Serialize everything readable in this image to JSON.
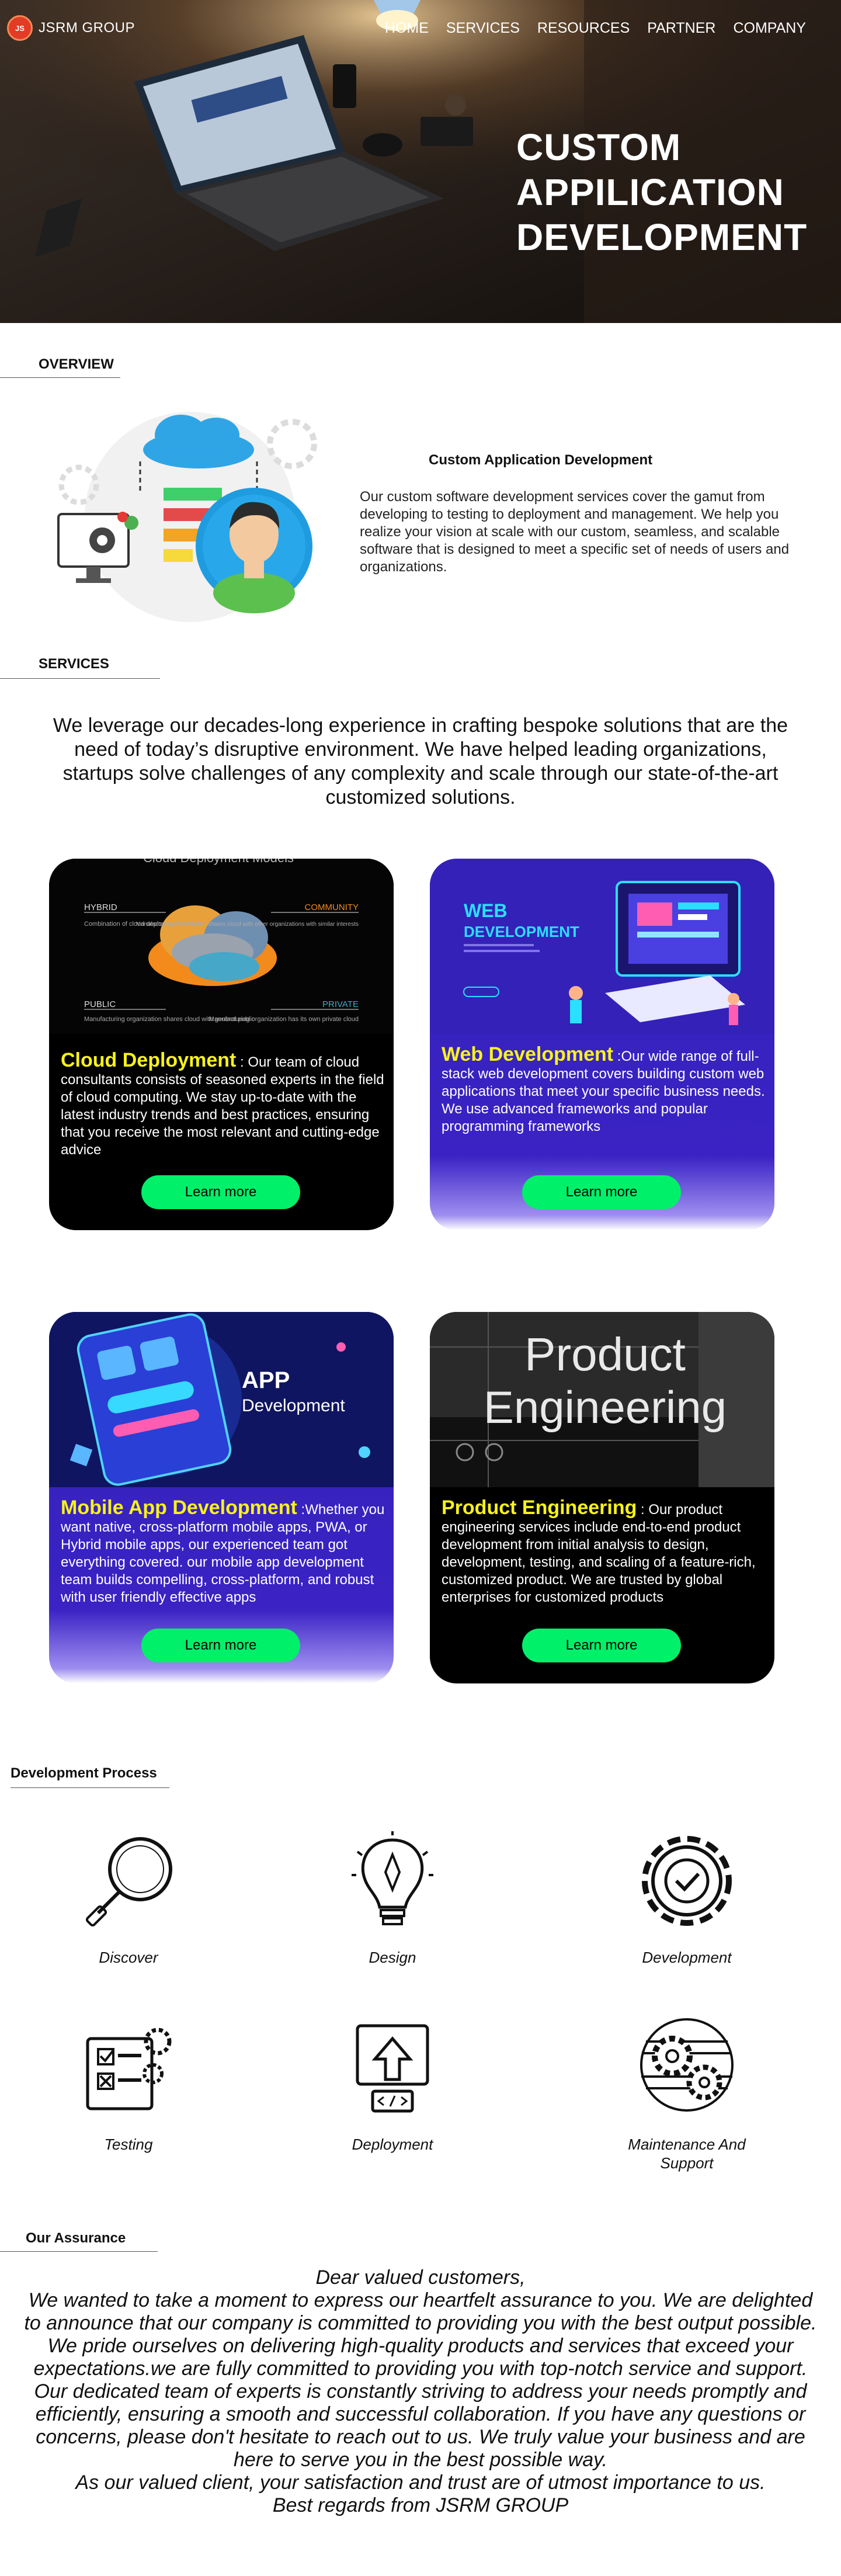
{
  "brand": {
    "name": "JSRM GROUP",
    "badge": "JS"
  },
  "nav": [
    "HOME",
    "SERVICES",
    "RESOURCES",
    "PARTNER",
    "COMPANY"
  ],
  "hero": {
    "title_lines": [
      "CUSTOM",
      "APPILICATION",
      "DEVELOPMENT"
    ]
  },
  "sections": {
    "overview": "OVERVIEW",
    "services": "SERVICES",
    "process": "Development Process",
    "assurance": "Our Assurance"
  },
  "overview": {
    "title": "Custom Application Development",
    "body": "Our custom software development services cover the gamut from developing to testing to deployment and management. We help you realize your vision at scale with our custom, seamless, and scalable software that is designed to meet a specific set of needs of users and organizations."
  },
  "services_intro": "We leverage our decades-long experience in crafting bespoke solutions that are the need of today’s disruptive environment. We have helped leading organizations, startups solve challenges of any complexity and scale through our state-of-the-art customized solutions.",
  "cards": [
    {
      "heading": "Cloud Deployment",
      "body": " : Our team of cloud consultants consists of seasoned experts in the field of cloud computing. We stay up-to-date with the latest industry trends and best practices, ensuring that you receive the most relevant and cutting-edge advice",
      "button": "Learn more",
      "image_text": {
        "title": "Cloud Deployment Models",
        "hybrid": "HYBRID",
        "hybrid_desc": "Combination of cloud deployment models",
        "community": "COMMUNITY",
        "community_desc": "Manufacturing organization shares cloud with other organizations with similar interests",
        "public": "PUBLIC",
        "public_desc": "Manufacturing organization shares cloud with general public",
        "private": "PRIVATE",
        "private_desc": "Manufacturing organization has its own private cloud"
      }
    },
    {
      "heading": "Web Development",
      "body": " :Our wide range of full-stack web development covers building custom web applications that meet your specific business needs. We use advanced frameworks and popular programming frameworks",
      "button": "Learn more",
      "image_text": {
        "line1": "WEB",
        "line2": "DEVELOPMENT"
      }
    },
    {
      "heading": "Mobile App Development",
      "body": "  :Whether you want native, cross-platform mobile apps, PWA, or Hybrid mobile apps, our experienced team got everything covered. our mobile app development team builds compelling, cross-platform, and robust with user friendly effective apps",
      "button": "Learn more",
      "image_text": {
        "line1": "APP",
        "line2": "Development"
      }
    },
    {
      "heading": "Product Engineering",
      "body": " : Our product engineering services include end-to-end product development from initial analysis to design, development, testing, and scaling of a feature-rich, customized product. We are trusted by global enterprises for customized products",
      "button": "Learn more",
      "image_text": {
        "line1": "Product",
        "line2": "Engineering"
      }
    }
  ],
  "process": [
    {
      "label": "Discover",
      "icon": "magnifier-icon"
    },
    {
      "label": "Design",
      "icon": "lightbulb-pen-icon"
    },
    {
      "label": "Development",
      "icon": "gear-check-icon"
    },
    {
      "label": "Testing",
      "icon": "checklist-gears-icon"
    },
    {
      "label": "Deployment",
      "icon": "upload-monitor-icon"
    },
    {
      "label": "Maintenance And Support",
      "icon": "gears-circle-icon"
    }
  ],
  "assurance": [
    "Dear valued customers,",
    "We wanted to take a moment to express our heartfelt assurance to you. We are delighted to announce that our company is committed to providing you with the best output possible. We pride ourselves on delivering high-quality products and services that exceed your expectations.we are fully committed to providing you with top-notch service and support. Our dedicated team of experts is constantly striving to address your needs promptly and efficiently, ensuring a smooth and successful collaboration. If you have any questions or concerns, please don't hesitate to reach out to us. We truly value your business and are here to serve you in the best possible way.",
    "As our valued client, your satisfaction and trust are of utmost importance to us.",
    "Best regards from JSRM GROUP"
  ],
  "colors": {
    "accent_green": "#00f06a",
    "heading_yellow": "#f6f21c",
    "purple": "#3421b8"
  }
}
